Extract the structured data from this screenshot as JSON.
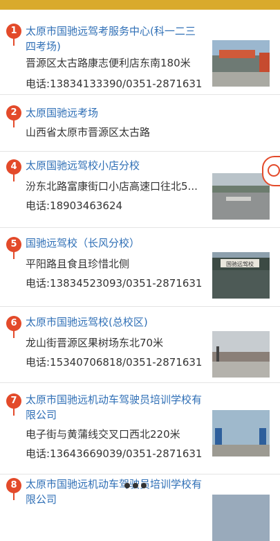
{
  "results": [
    {
      "num": "1",
      "title": "太原市国驰远驾考服务中心(科一二三四考场)",
      "address": "晋源区太古路康志便利店东南180米",
      "phone": "电话:13834133390/0351-2871631",
      "has_photo": true
    },
    {
      "num": "2",
      "title": "太原国驰远考场",
      "address": "山西省太原市晋源区太古路",
      "phone": "",
      "has_photo": false
    },
    {
      "num": "4",
      "title": "太原国驰远驾校小店分校",
      "address": "汾东北路富康街口小店高速口往北5...",
      "phone": "电话:18903463624",
      "has_photo": true
    },
    {
      "num": "5",
      "title": "国驰远驾校（长风分校）",
      "address": "平阳路且食且珍惜北侧",
      "phone": "电话:13834523093/0351-2871631",
      "has_photo": true,
      "photo_sign": "国驰远驾校"
    },
    {
      "num": "6",
      "title": "太原市国驰远驾校(总校区)",
      "address": "龙山街晋源区果树场东北70米",
      "phone": "电话:15340706818/0351-2871631",
      "has_photo": true
    },
    {
      "num": "7",
      "title": "太原市国驰远机动车驾驶员培训学校有限公司",
      "address": "电子街与黄蒲线交叉口西北220米",
      "phone": "电话:13643669039/0351-2871631",
      "has_photo": true
    },
    {
      "num": "8",
      "title": "太原市国驰远机动车驾驶员培训学校有限公司",
      "address": "",
      "phone": "",
      "has_photo": true
    }
  ],
  "colors": {
    "accent": "#d9aa2c",
    "pin": "#e34a2a",
    "link": "#2f6fb6"
  }
}
